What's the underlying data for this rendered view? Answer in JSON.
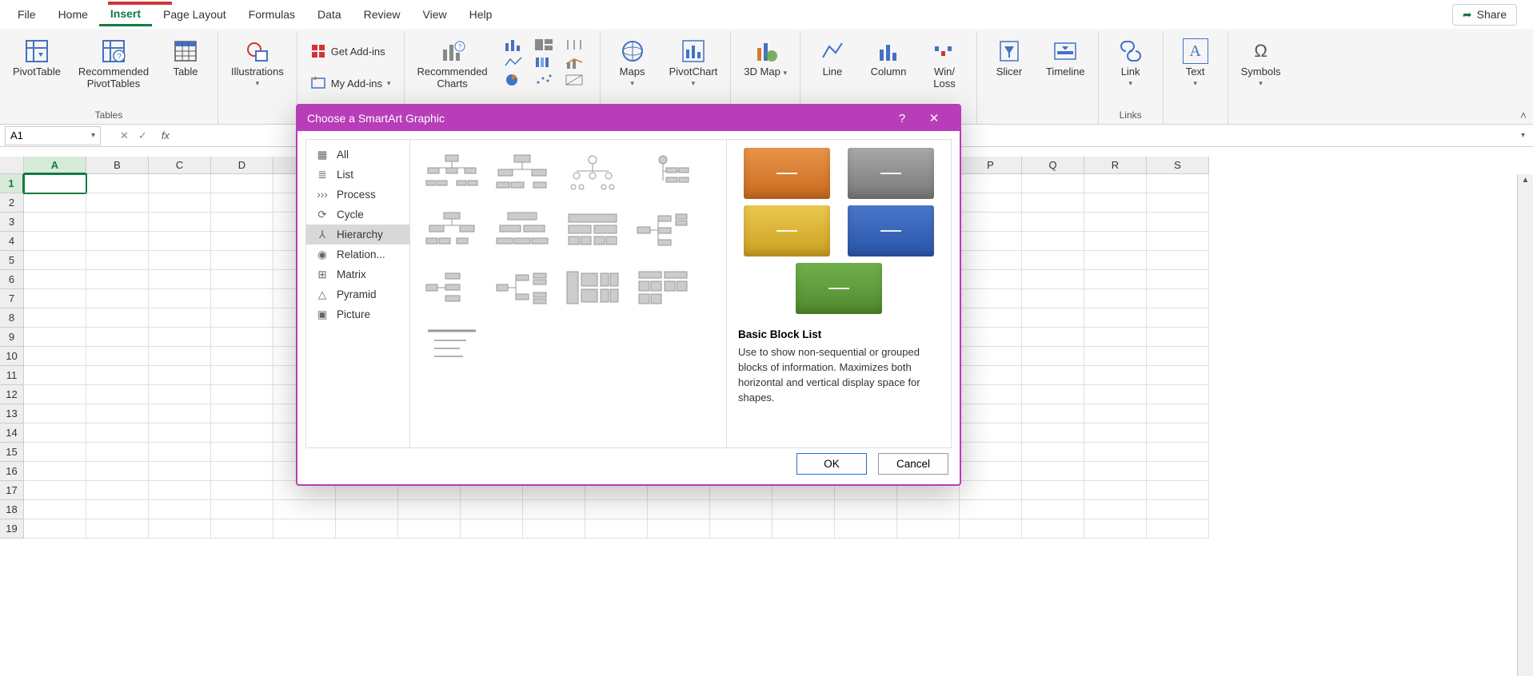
{
  "menubar": [
    "File",
    "Home",
    "Insert",
    "Page Layout",
    "Formulas",
    "Data",
    "Review",
    "View",
    "Help"
  ],
  "menubar_active": "Insert",
  "share_label": "Share",
  "ribbon": {
    "tables": {
      "pivot": "PivotTable",
      "rec_pivot": "Recommended PivotTables",
      "table": "Table",
      "group": "Tables"
    },
    "illustrations": {
      "label": "Illustrations"
    },
    "addins": {
      "get": "Get Add-ins",
      "my": "My Add-ins"
    },
    "charts": {
      "rec": "Recommended Charts"
    },
    "maps": "Maps",
    "pivotchart": "PivotChart",
    "map3d": "3D Map",
    "sparklines": {
      "line": "Line",
      "column": "Column",
      "winloss": "Win/\nLoss"
    },
    "filters": {
      "slicer": "Slicer",
      "timeline": "Timeline"
    },
    "links": {
      "link": "Link",
      "group": "Links"
    },
    "text": "Text",
    "symbols": "Symbols"
  },
  "namebox": "A1",
  "fx_label": "fx",
  "columns": [
    "A",
    "B",
    "C",
    "D",
    "",
    "",
    "",
    "",
    "",
    "",
    "",
    "",
    "",
    "",
    "",
    "P",
    "Q",
    "R",
    "S"
  ],
  "rows": [
    "1",
    "2",
    "3",
    "4",
    "5",
    "6",
    "7",
    "8",
    "9",
    "10",
    "11",
    "12",
    "13",
    "14",
    "15",
    "16",
    "17",
    "18",
    "19"
  ],
  "dialog": {
    "title": "Choose a SmartArt Graphic",
    "categories": [
      "All",
      "List",
      "Process",
      "Cycle",
      "Hierarchy",
      "Relation...",
      "Matrix",
      "Pyramid",
      "Picture"
    ],
    "selected_category": "Hierarchy",
    "preview_title": "Basic Block List",
    "preview_desc": "Use to show non-sequential or grouped blocks of information. Maximizes both horizontal and vertical display space for shapes.",
    "ok": "OK",
    "cancel": "Cancel",
    "preview_colors": [
      "#d97b2d",
      "#8a8a8a",
      "#d9b23a",
      "#2f5fb3",
      "#5b9c3a"
    ]
  }
}
